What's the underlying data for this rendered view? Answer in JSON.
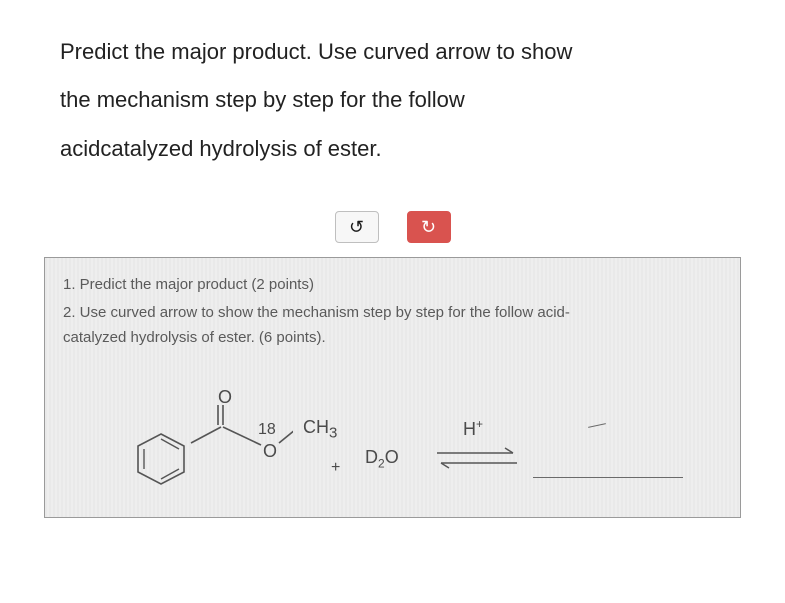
{
  "prompt": {
    "line1": "Predict the major product. Use curved arrow to show",
    "line2": "the mechanism step by step for the follow",
    "line3": "acidcatalyzed hydrolysis of ester."
  },
  "buttons": {
    "undo_glyph": "↺",
    "redo_glyph": "↻"
  },
  "panel": {
    "q1": "1. Predict the major product (2 points)",
    "q2a": "2. Use curved arrow to show the mechanism step by step for the follow acid-",
    "q2b": "catalyzed hydrolysis of ester. (6 points)."
  },
  "chem": {
    "oxy_top": "O",
    "label18": "18",
    "oxy_mid": "O",
    "ch3": "CH",
    "ch3_sub": "3",
    "plus": "+",
    "d2o_D": "D",
    "d2o_sub": "2",
    "d2o_O": "O",
    "hcat_H": "H",
    "hcat_sup": "+"
  }
}
